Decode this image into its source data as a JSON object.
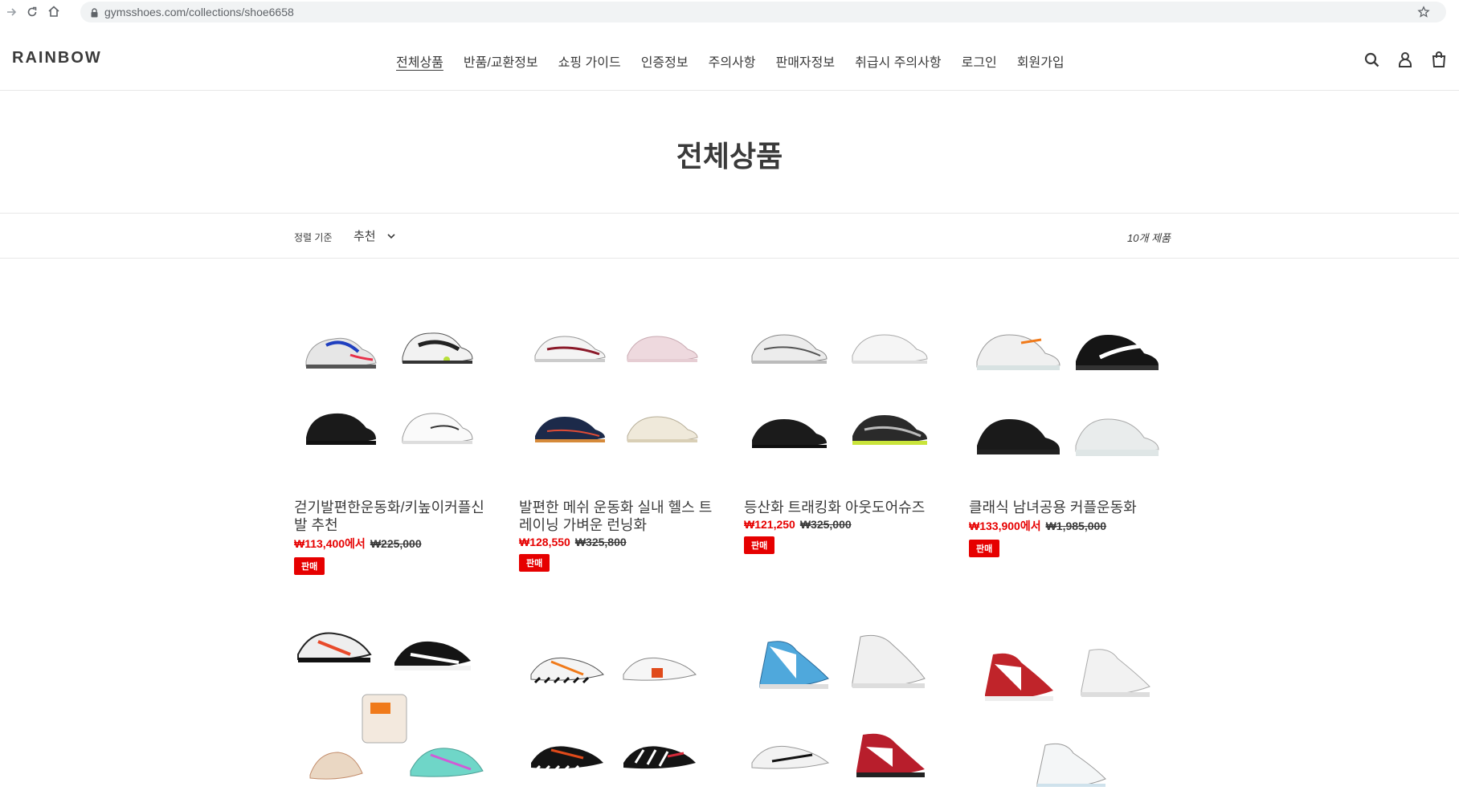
{
  "browser": {
    "url": "gymsshoes.com/collections/shoe6658"
  },
  "header": {
    "logo": "RAINBOW",
    "nav": [
      {
        "label": "전체상품"
      },
      {
        "label": "반품/교환정보"
      },
      {
        "label": "쇼핑 가이드"
      },
      {
        "label": "인증정보"
      },
      {
        "label": "주의사항"
      },
      {
        "label": "판매자정보"
      },
      {
        "label": "취급시 주의사항"
      },
      {
        "label": "로그인"
      },
      {
        "label": "회원가입"
      }
    ]
  },
  "page": {
    "title": "전체상품"
  },
  "filter": {
    "sort_label": "정렬 기준",
    "sort_value": "추천",
    "count": "10개 제품"
  },
  "products": [
    {
      "name": "걷기발편한운동화/키높이커플신발 추천",
      "sale_price": "₩113,400에서",
      "orig_price": "₩225,000",
      "badge": "판매"
    },
    {
      "name": "발편한 메쉬 운동화 실내 헬스 트레이닝 가벼운 런닝화",
      "sale_price": "₩128,550",
      "orig_price": "₩325,800",
      "badge": "판매"
    },
    {
      "name": "등산화 트래킹화 아웃도어슈즈",
      "sale_price": "₩121,250",
      "orig_price": "₩325,000",
      "badge": "판매"
    },
    {
      "name": "클래식 남녀공용 커플운동화",
      "sale_price": "₩133,900에서",
      "orig_price": "₩1,985,000",
      "badge": "판매"
    }
  ],
  "colors": {
    "sale": "#e60000",
    "text": "#3a3a3a"
  }
}
